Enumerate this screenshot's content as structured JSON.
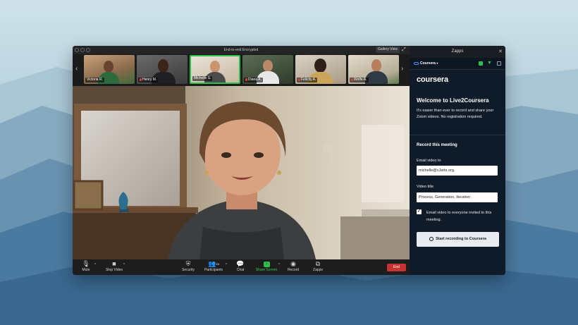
{
  "window": {
    "title": "End-to-end Encrypted",
    "view_button": "Gallery View"
  },
  "participants": [
    {
      "name": "Victoria R.",
      "muted": false,
      "active": false
    },
    {
      "name": "Henry M.",
      "muted": true,
      "active": false
    },
    {
      "name": "Michelle S.",
      "muted": false,
      "active": true
    },
    {
      "name": "Diana A.",
      "muted": true,
      "active": false
    },
    {
      "name": "Felicity A.",
      "muted": true,
      "active": false
    },
    {
      "name": "Wolfe A.",
      "muted": true,
      "active": false
    }
  ],
  "toolbar": {
    "mute": "Mute",
    "stop_video": "Stop Video",
    "security": "Security",
    "participants": "Participants",
    "participants_count": "23",
    "chat": "Chat",
    "share_screen": "Share Screen",
    "record": "Record",
    "zapps": "Zapps",
    "end": "End"
  },
  "panel": {
    "header": "Zapps",
    "app_name": "Coursera",
    "brand": "coursera",
    "welcome": "Welcome to Live2Coursera",
    "description": "It's easier than ever to record and share your Zoom videos. No registration required.",
    "section_title": "Record this meeting",
    "email_label": "Email video to",
    "email_value": "michelle@cJarts.org.",
    "title_label": "Video title",
    "title_value": "Process, Generation, Iteration",
    "checkbox_checked": true,
    "checkbox_label": "Email video to everyone invited to this meeting.",
    "cta": "Start recording to Coursera"
  },
  "colors": {
    "accent_green": "#2fbf4b",
    "end_red": "#c83232",
    "panel_bg": "#0f1b28"
  }
}
